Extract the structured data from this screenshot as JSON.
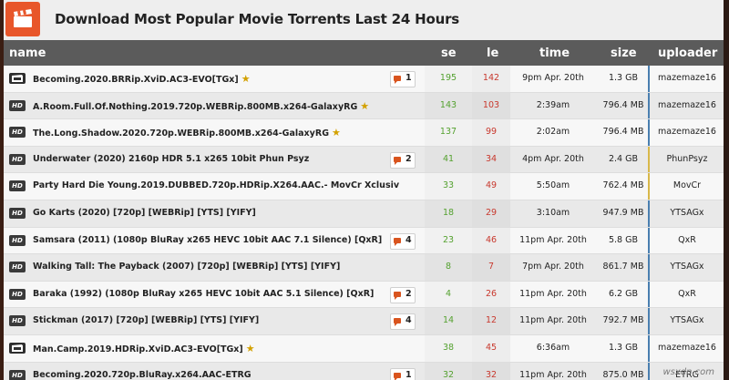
{
  "header": {
    "title": "Download Most Popular Movie Torrents Last 24 Hours"
  },
  "columns": {
    "name": "name",
    "se": "se",
    "le": "le",
    "time": "time",
    "size": "size",
    "uploader": "uploader"
  },
  "colors": {
    "seeders": "#54a12f",
    "leechers": "#c8382d",
    "vip_bar": "#4a7fb0",
    "trusted_bar": "#d8b84a",
    "accent": "#e8562a"
  },
  "rows": [
    {
      "cat": "film",
      "name": "Becoming.2020.BRRip.XviD.AC3-EVO[TGx]",
      "star": true,
      "comments": "1",
      "se": "195",
      "le": "142",
      "time": "9pm Apr. 20th",
      "size": "1.3 GB",
      "uploader": "mazemaze16",
      "badge": "vip"
    },
    {
      "cat": "HD",
      "name": "A.Room.Full.Of.Nothing.2019.720p.WEBRip.800MB.x264-GalaxyRG",
      "star": true,
      "comments": "",
      "se": "143",
      "le": "103",
      "time": "2:39am",
      "size": "796.4 MB",
      "uploader": "mazemaze16",
      "badge": "vip"
    },
    {
      "cat": "HD",
      "name": "The.Long.Shadow.2020.720p.WEBRip.800MB.x264-GalaxyRG",
      "star": true,
      "comments": "",
      "se": "137",
      "le": "99",
      "time": "2:02am",
      "size": "796.4 MB",
      "uploader": "mazemaze16",
      "badge": "vip"
    },
    {
      "cat": "HD",
      "name": "Underwater (2020) 2160p HDR 5.1 x265 10bit Phun Psyz",
      "star": false,
      "comments": "2",
      "se": "41",
      "le": "34",
      "time": "4pm Apr. 20th",
      "size": "2.4 GB",
      "uploader": "PhunPsyz",
      "badge": "trusted"
    },
    {
      "cat": "HD",
      "name": "Party Hard Die Young.2019.DUBBED.720p.HDRip.X264.AAC.- MovCr Xclusiv",
      "star": false,
      "comments": "",
      "se": "33",
      "le": "49",
      "time": "5:50am",
      "size": "762.4 MB",
      "uploader": "MovCr",
      "badge": "trusted"
    },
    {
      "cat": "HD",
      "name": "Go Karts (2020) [720p] [WEBRip] [YTS] [YIFY]",
      "star": false,
      "comments": "",
      "se": "18",
      "le": "29",
      "time": "3:10am",
      "size": "947.9 MB",
      "uploader": "YTSAGx",
      "badge": "vip"
    },
    {
      "cat": "HD",
      "name": "Samsara (2011) (1080p BluRay x265 HEVC 10bit AAC 7.1 Silence) [QxR]",
      "star": false,
      "comments": "4",
      "se": "23",
      "le": "46",
      "time": "11pm Apr. 20th",
      "size": "5.8 GB",
      "uploader": "QxR",
      "badge": "vip"
    },
    {
      "cat": "HD",
      "name": "Walking Tall: The Payback (2007) [720p] [WEBRip] [YTS] [YIFY]",
      "star": false,
      "comments": "",
      "se": "8",
      "le": "7",
      "time": "7pm Apr. 20th",
      "size": "861.7 MB",
      "uploader": "YTSAGx",
      "badge": "vip"
    },
    {
      "cat": "HD",
      "name": "Baraka (1992) (1080p BluRay x265 HEVC 10bit AAC 5.1 Silence) [QxR]",
      "star": false,
      "comments": "2",
      "se": "4",
      "le": "26",
      "time": "11pm Apr. 20th",
      "size": "6.2 GB",
      "uploader": "QxR",
      "badge": "vip"
    },
    {
      "cat": "HD",
      "name": "Stickman (2017) [720p] [WEBRip] [YTS] [YIFY]",
      "star": false,
      "comments": "4",
      "se": "14",
      "le": "12",
      "time": "11pm Apr. 20th",
      "size": "792.7 MB",
      "uploader": "YTSAGx",
      "badge": "vip"
    },
    {
      "cat": "film",
      "name": "Man.Camp.2019.HDRip.XviD.AC3-EVO[TGx]",
      "star": true,
      "comments": "",
      "se": "38",
      "le": "45",
      "time": "6:36am",
      "size": "1.3 GB",
      "uploader": "mazemaze16",
      "badge": "vip"
    },
    {
      "cat": "HD",
      "name": "Becoming.2020.720p.BluRay.x264.AAC-ETRG",
      "star": false,
      "comments": "1",
      "se": "32",
      "le": "32",
      "time": "11pm Apr. 20th",
      "size": "875.0 MB",
      "uploader": "ETRG",
      "badge": "vip"
    }
  ],
  "watermark": "wsxdn.com"
}
